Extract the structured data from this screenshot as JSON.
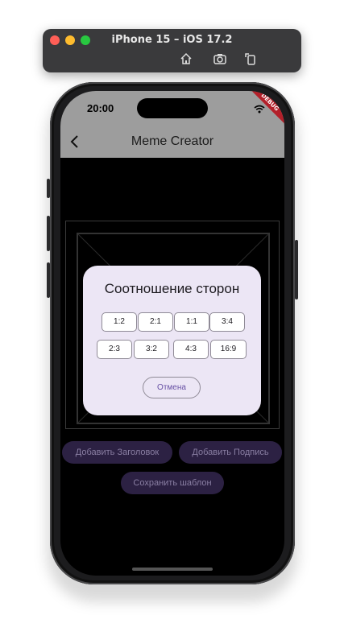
{
  "simulator": {
    "window_title": "iPhone 15 – iOS 17.2",
    "toolbar_icons": [
      "home-icon",
      "screenshot-icon",
      "rotate-icon"
    ]
  },
  "status_bar": {
    "time": "20:00",
    "icons": [
      "wifi-icon",
      "battery-icon"
    ],
    "debug_banner": "DEBUG"
  },
  "app_bar": {
    "title": "Meme Creator",
    "back_icon": "chevron-left-icon"
  },
  "actions": {
    "add_title": "Добавить Заголовок",
    "add_caption": "Добавить Подпись",
    "save_template": "Сохранить шаблон"
  },
  "dialog": {
    "title": "Соотношение сторон",
    "ratios": [
      "1:2",
      "2:1",
      "1:1",
      "3:4",
      "2:3",
      "3:2",
      "4:3",
      "16:9"
    ],
    "cancel": "Отмена"
  },
  "colors": {
    "app_bar": "#9d9d9d",
    "dialog_bg": "#ece6f5",
    "accent": "#6750a4",
    "pill_bg": "#2c2143",
    "debug_ribbon": "#b3202a"
  }
}
